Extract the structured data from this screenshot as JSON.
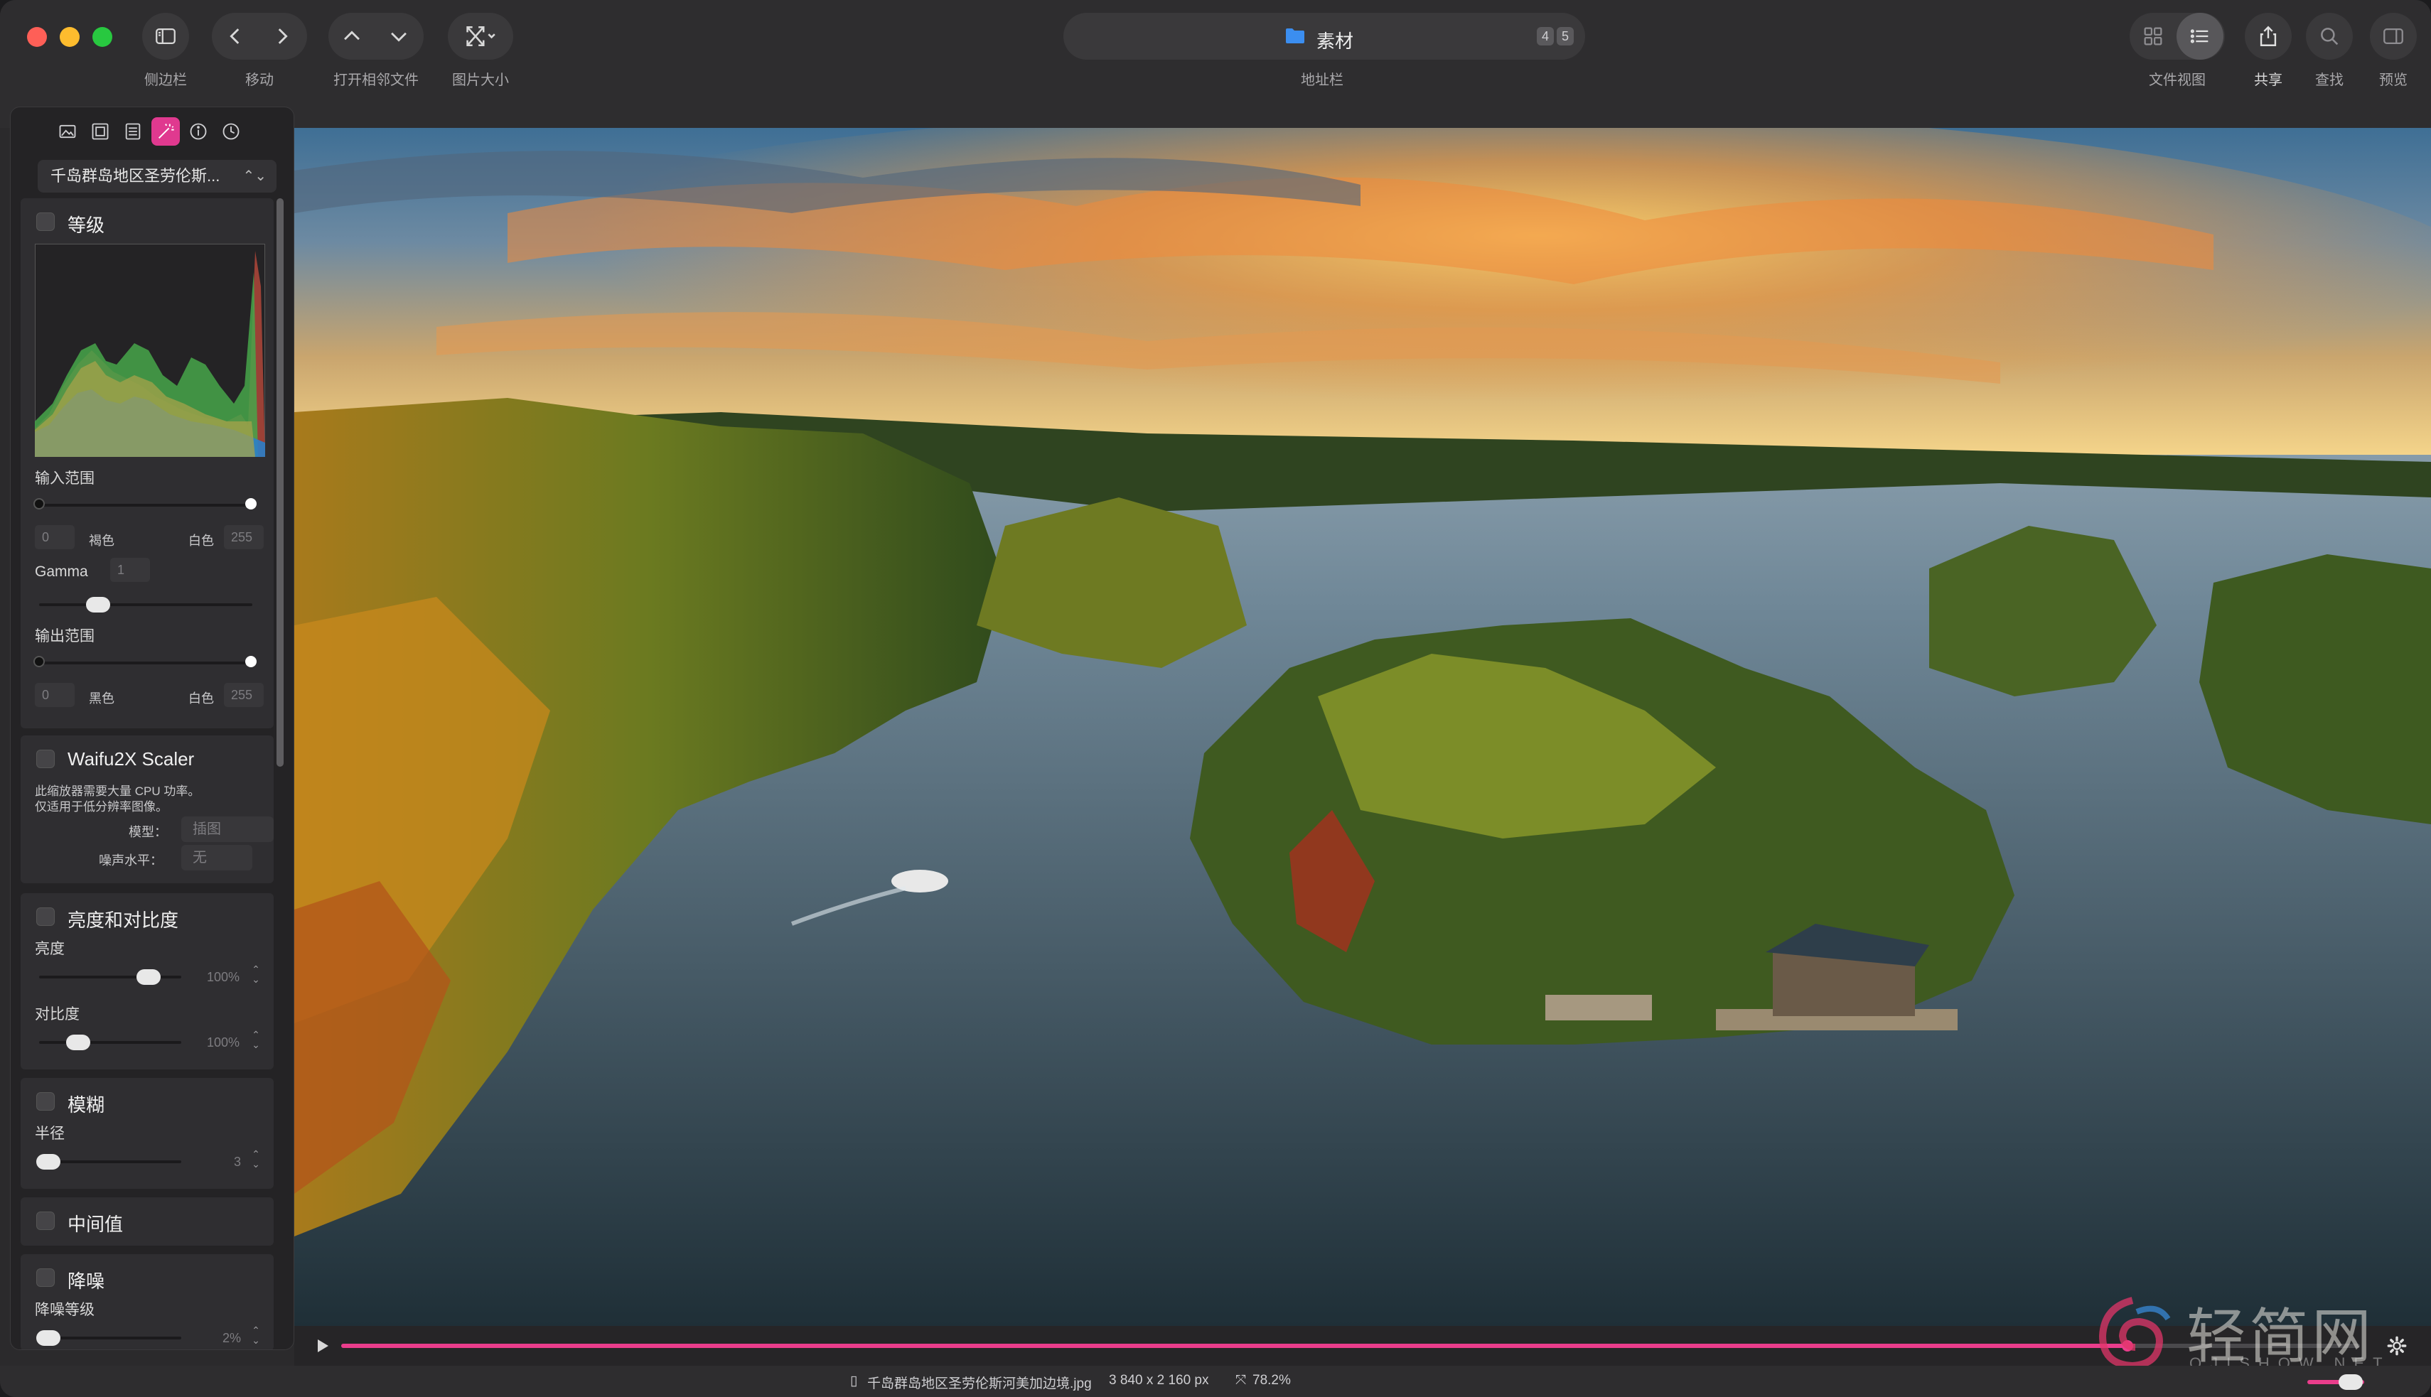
{
  "toolbar": {
    "sidebar_label": "侧边栏",
    "move_label": "移动",
    "open_adjacent_label": "打开相邻文件",
    "image_size_label": "图片大小",
    "address_label": "地址栏",
    "address_folder": "素材",
    "address_badge_a": "4",
    "address_badge_b": "5",
    "file_view_label": "文件视图",
    "share_label": "共享",
    "find_label": "查找",
    "preview_label": "预览"
  },
  "panel": {
    "tabs": [
      "image-icon",
      "crop-icon",
      "list-icon",
      "wand-icon",
      "info-icon",
      "clock-icon"
    ],
    "active_tab": "wand-icon",
    "preset": "千岛群岛地区圣劳伦斯...",
    "levels": {
      "title": "等级",
      "input_range": "输入范围",
      "in_low": "0",
      "in_low_label": "褐色",
      "in_high_label": "白色",
      "in_high": "255",
      "gamma_label": "Gamma",
      "gamma": "1",
      "output_range": "输出范围",
      "out_low": "0",
      "out_low_label": "黑色",
      "out_high_label": "白色",
      "out_high": "255"
    },
    "waifu": {
      "title": "Waifu2X Scaler",
      "note_line1": "此缩放器需要大量 CPU 功率。",
      "note_line2": "仅适用于低分辨率图像。",
      "model_label": "模型：",
      "model_value": "插图",
      "noise_label": "噪声水平：",
      "noise_value": "无"
    },
    "brightness_contrast": {
      "title": "亮度和对比度",
      "brightness_label": "亮度",
      "brightness_value": "100%",
      "brightness_level": 0.85,
      "contrast_label": "对比度",
      "contrast_value": "100%",
      "contrast_level": 0.25
    },
    "blur": {
      "title": "模糊",
      "radius_label": "半径",
      "radius_value": "3"
    },
    "median": {
      "title": "中间值"
    },
    "denoise": {
      "title": "降噪",
      "level_label": "降噪等级",
      "level_value": "2%"
    }
  },
  "player": {
    "progress": 0.885
  },
  "status": {
    "filename": "千岛群岛地区圣劳伦斯河美加边境.jpg",
    "dimensions": "3 840 x 2 160 px",
    "zoom": "78.2%"
  },
  "watermark": {
    "text": "轻简网",
    "sub": "QJISHOW.NET"
  },
  "colors": {
    "accent": "#ea3d8c",
    "close": "#fe5f57",
    "minimize": "#febc2e",
    "maximize": "#28c840",
    "folder": "#3b8ef0"
  }
}
